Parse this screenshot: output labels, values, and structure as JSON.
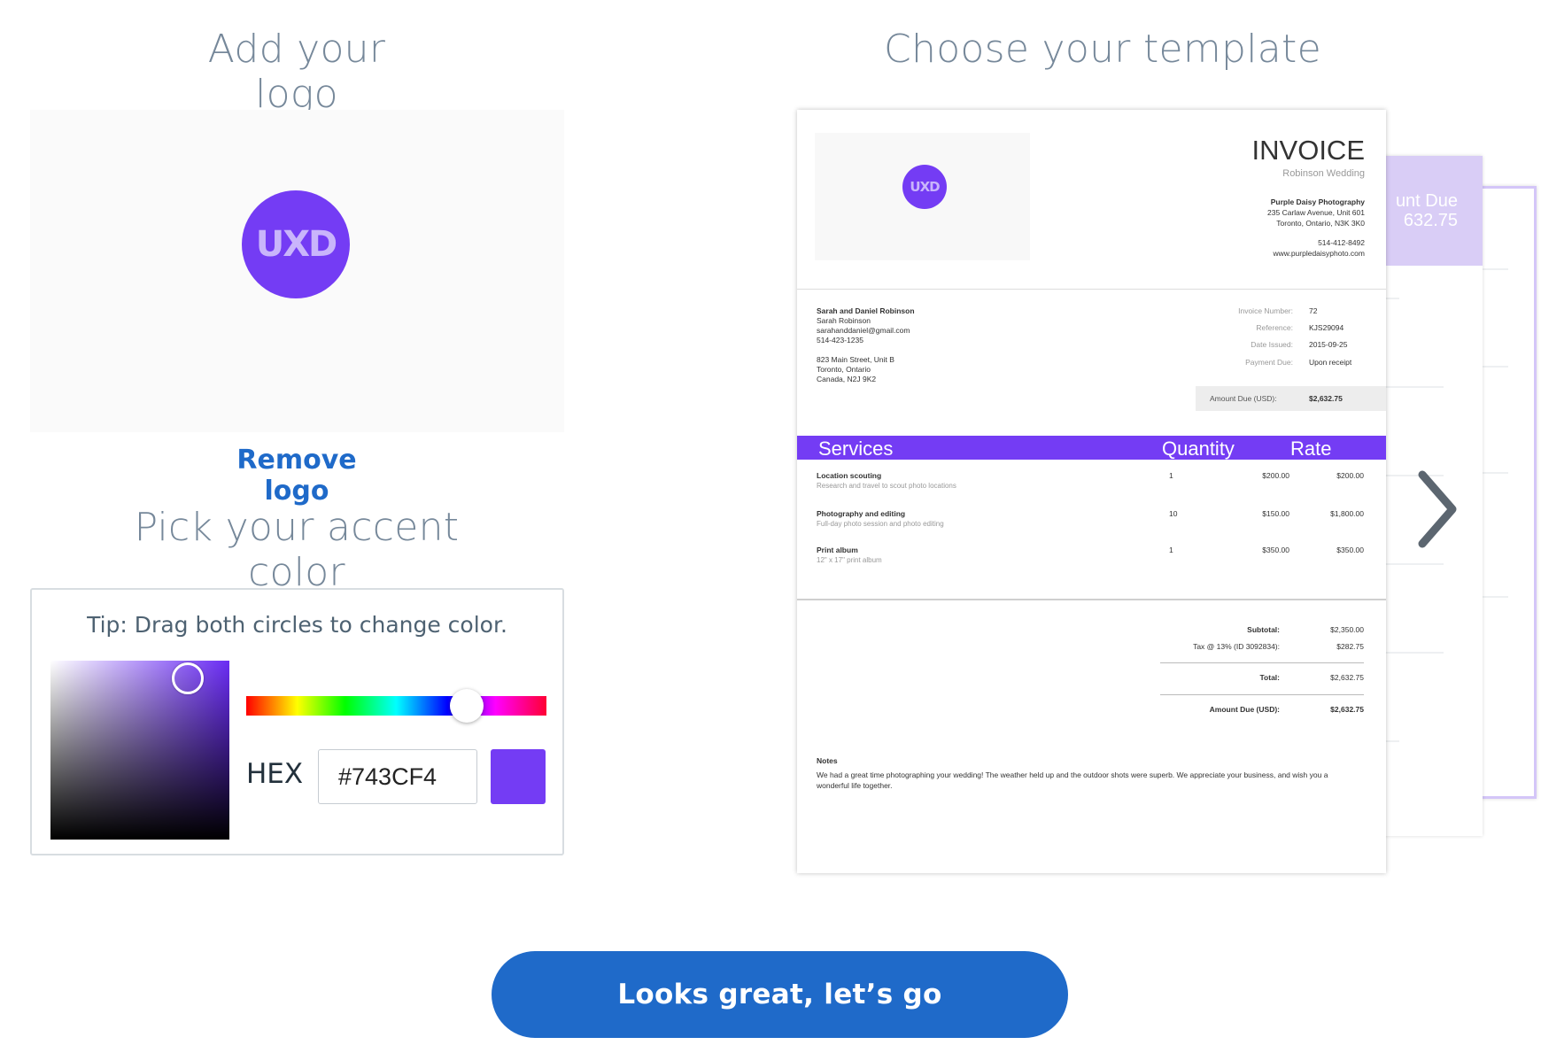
{
  "headings": {
    "add_logo": "Add your logo",
    "choose_template": "Choose your template",
    "accent_color": "Pick your accent color"
  },
  "logo": {
    "text": "UXD",
    "remove_label": "Remove logo"
  },
  "color_picker": {
    "tip": "Tip: Drag both circles to change color.",
    "hex_label": "HEX",
    "hex_value": "#743CF4",
    "accent_color": "#743CF4"
  },
  "invoice": {
    "title": "INVOICE",
    "subtitle": "Robinson Wedding",
    "company_name": "Purple Daisy Photography",
    "company_address_1": "235 Carlaw Avenue, Unit 601",
    "company_address_2": "Toronto, Ontario, N3K 3K0",
    "company_phone": "514-412-8492",
    "company_web": "www.purpledaisyphoto.com",
    "client_name": "Sarah and Daniel Robinson",
    "client_contact": "Sarah Robinson",
    "client_email": "sarahanddaniel@gmail.com",
    "client_phone": "514-423-1235",
    "client_address_1": "823 Main Street, Unit B",
    "client_address_2": "Toronto, Ontario",
    "client_address_3": "Canada, N2J 9K2",
    "meta": [
      {
        "label": "Invoice Number:",
        "value": "72"
      },
      {
        "label": "Reference:",
        "value": "KJS29094"
      },
      {
        "label": "Date Issued:",
        "value": "2015-09-25"
      },
      {
        "label": "Payment Due:",
        "value": "Upon receipt"
      }
    ],
    "amount_due_label": "Amount Due (USD):",
    "amount_due_value": "$2,632.75",
    "columns": {
      "services": "Services",
      "quantity": "Quantity",
      "rate": "Rate"
    },
    "items": [
      {
        "title": "Location scouting",
        "desc": "Research and travel to scout photo locations",
        "qty": "1",
        "price": "$200.00",
        "amount": "$200.00"
      },
      {
        "title": "Photography and editing",
        "desc": "Full-day photo session and photo editing",
        "qty": "10",
        "price": "$150.00",
        "amount": "$1,800.00"
      },
      {
        "title": "Print album",
        "desc": "12\" x 17\" print album",
        "qty": "1",
        "price": "$350.00",
        "amount": "$350.00"
      }
    ],
    "subtotal_label": "Subtotal:",
    "subtotal_value": "$2,350.00",
    "tax_label": "Tax @ 13% (ID 3092834):",
    "tax_value": "$282.75",
    "total_label": "Total:",
    "total_value": "$2,632.75",
    "amount_due_total_label": "Amount Due (USD):",
    "amount_due_total_value": "$2,632.75",
    "notes_title": "Notes",
    "notes_body": "We had a great time photographing your wedding! The weather held up and the outdoor shots were superb. We appreciate your business, and wish you a wonderful life together."
  },
  "back_template": {
    "band_text_1": "unt Due",
    "band_text_2": "632.75"
  },
  "cta": {
    "label": "Looks great, let’s go"
  }
}
